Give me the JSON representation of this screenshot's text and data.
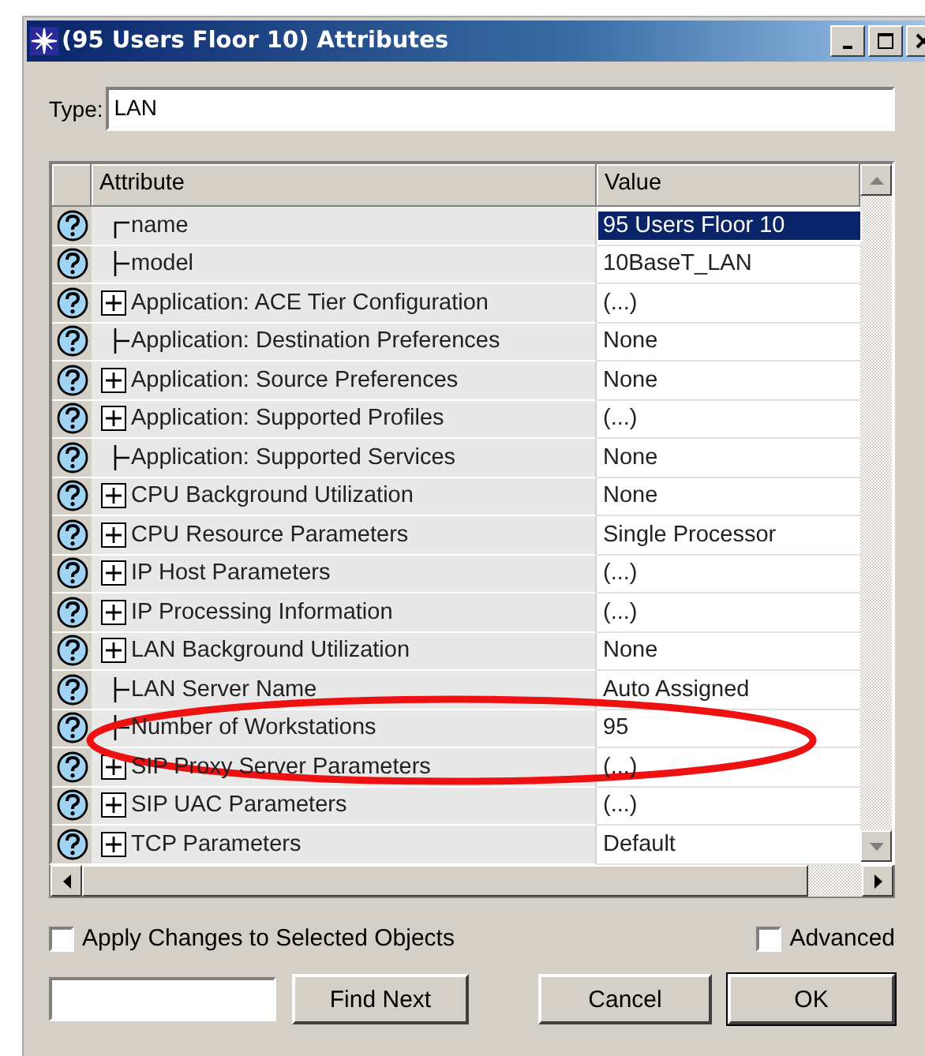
{
  "window": {
    "title": "(95 Users Floor 10) Attributes"
  },
  "type_field": {
    "label": "Type:",
    "value": "LAN"
  },
  "table": {
    "columns": [
      "Attribute",
      "Value"
    ],
    "rows": [
      {
        "kind": "top",
        "attribute": "name",
        "value": "95 Users Floor 10",
        "selected": true
      },
      {
        "kind": "leaf",
        "attribute": "model",
        "value": "10BaseT_LAN",
        "selected": false
      },
      {
        "kind": "group",
        "attribute": "Application: ACE Tier Configuration",
        "value": "(...)",
        "selected": false
      },
      {
        "kind": "leaf",
        "attribute": "Application: Destination Preferences",
        "value": "None",
        "selected": false
      },
      {
        "kind": "group",
        "attribute": "Application: Source Preferences",
        "value": "None",
        "selected": false
      },
      {
        "kind": "group",
        "attribute": "Application: Supported Profiles",
        "value": "(...)",
        "selected": false
      },
      {
        "kind": "leaf",
        "attribute": "Application: Supported Services",
        "value": "None",
        "selected": false
      },
      {
        "kind": "group",
        "attribute": "CPU Background Utilization",
        "value": "None",
        "selected": false
      },
      {
        "kind": "group",
        "attribute": "CPU Resource Parameters",
        "value": "Single Processor",
        "selected": false
      },
      {
        "kind": "group",
        "attribute": "IP Host Parameters",
        "value": "(...)",
        "selected": false
      },
      {
        "kind": "group",
        "attribute": "IP Processing Information",
        "value": "(...)",
        "selected": false
      },
      {
        "kind": "group",
        "attribute": "LAN Background Utilization",
        "value": "None",
        "selected": false
      },
      {
        "kind": "leaf",
        "attribute": "LAN Server Name",
        "value": "Auto Assigned",
        "selected": false
      },
      {
        "kind": "leaf",
        "attribute": "Number of Workstations",
        "value": "95",
        "selected": false
      },
      {
        "kind": "group",
        "attribute": "SIP Proxy Server Parameters",
        "value": "(...)",
        "selected": false
      },
      {
        "kind": "group",
        "attribute": "SIP UAC Parameters",
        "value": "(...)",
        "selected": false
      },
      {
        "kind": "group",
        "attribute": "TCP Parameters",
        "value": "Default",
        "selected": false
      }
    ]
  },
  "options": [
    {
      "label": "Apply Changes to Selected Objects",
      "checked": false
    },
    {
      "label": "Advanced",
      "checked": false
    }
  ],
  "find": {
    "button": "Find Next"
  },
  "buttons": [
    {
      "label": "Cancel",
      "default": false
    },
    {
      "label": "OK",
      "default": true
    }
  ]
}
